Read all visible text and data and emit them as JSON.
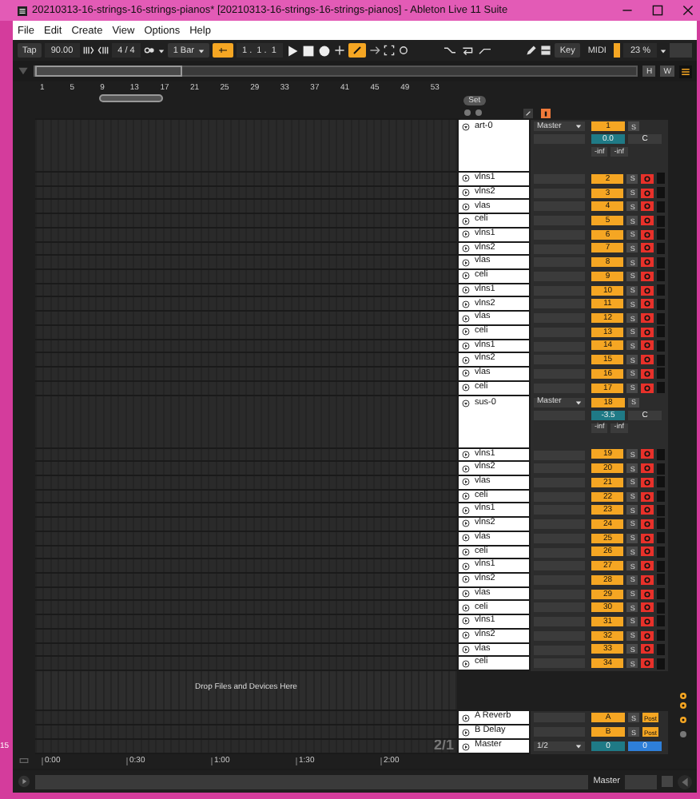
{
  "window": {
    "title": "20210313-16-strings-16-strings-pianos* [20210313-16-strings-16-strings-pianos] - Ableton Live 11 Suite"
  },
  "desktop_label": "15",
  "menu": [
    "File",
    "Edit",
    "Create",
    "View",
    "Options",
    "Help"
  ],
  "transport": {
    "tap": "Tap",
    "tempo": "90.00",
    "signature": "4 / 4",
    "quantization": "1 Bar",
    "position": "1 .  1 .  1",
    "follow_on": true,
    "automation_arm": true,
    "key": "Key",
    "midi": "MIDI",
    "cpu": "23 %"
  },
  "overview": {
    "buttons": [
      "H",
      "W"
    ]
  },
  "ruler": {
    "bars": [
      "1",
      "5",
      "9",
      "13",
      "17",
      "21",
      "25",
      "29",
      "33",
      "37",
      "41",
      "45",
      "49",
      "53"
    ]
  },
  "set_button": "Set",
  "groups": [
    {
      "name": "art-0",
      "output": "Master",
      "number": "1",
      "solo": "S",
      "volume": "0.0",
      "pan": "C",
      "peaks": [
        "-inf",
        "-inf"
      ],
      "tracks": [
        {
          "name": "vlns1",
          "number": "2",
          "solo": "S",
          "armed": true
        },
        {
          "name": "vlns2",
          "number": "3",
          "solo": "S",
          "armed": true
        },
        {
          "name": "vlas",
          "number": "4",
          "solo": "S",
          "armed": true
        },
        {
          "name": "celi",
          "number": "5",
          "solo": "S",
          "armed": true
        },
        {
          "name": "vlns1",
          "number": "6",
          "solo": "S",
          "armed": true
        },
        {
          "name": "vlns2",
          "number": "7",
          "solo": "S",
          "armed": true
        },
        {
          "name": "vlas",
          "number": "8",
          "solo": "S",
          "armed": true
        },
        {
          "name": "celi",
          "number": "9",
          "solo": "S",
          "armed": true
        },
        {
          "name": "vlns1",
          "number": "10",
          "solo": "S",
          "armed": true
        },
        {
          "name": "vlns2",
          "number": "11",
          "solo": "S",
          "armed": true
        },
        {
          "name": "vlas",
          "number": "12",
          "solo": "S",
          "armed": true
        },
        {
          "name": "celi",
          "number": "13",
          "solo": "S",
          "armed": true
        },
        {
          "name": "vlns1",
          "number": "14",
          "solo": "S",
          "armed": true
        },
        {
          "name": "vlns2",
          "number": "15",
          "solo": "S",
          "armed": true
        },
        {
          "name": "vlas",
          "number": "16",
          "solo": "S",
          "armed": true
        },
        {
          "name": "celi",
          "number": "17",
          "solo": "S",
          "armed": true
        }
      ]
    },
    {
      "name": "sus-0",
      "output": "Master",
      "number": "18",
      "solo": "S",
      "volume": "-3.5",
      "pan": "C",
      "peaks": [
        "-inf",
        "-inf"
      ],
      "tracks": [
        {
          "name": "vlns1",
          "number": "19",
          "solo": "S",
          "armed": true
        },
        {
          "name": "vlns2",
          "number": "20",
          "solo": "S",
          "armed": true
        },
        {
          "name": "vlas",
          "number": "21",
          "solo": "S",
          "armed": true
        },
        {
          "name": "celi",
          "number": "22",
          "solo": "S",
          "armed": true
        },
        {
          "name": "vlns1",
          "number": "23",
          "solo": "S",
          "armed": true
        },
        {
          "name": "vlns2",
          "number": "24",
          "solo": "S",
          "armed": true
        },
        {
          "name": "vlas",
          "number": "25",
          "solo": "S",
          "armed": true
        },
        {
          "name": "celi",
          "number": "26",
          "solo": "S",
          "armed": true
        },
        {
          "name": "vlns1",
          "number": "27",
          "solo": "S",
          "armed": true
        },
        {
          "name": "vlns2",
          "number": "28",
          "solo": "S",
          "armed": true
        },
        {
          "name": "vlas",
          "number": "29",
          "solo": "S",
          "armed": true
        },
        {
          "name": "celi",
          "number": "30",
          "solo": "S",
          "armed": true
        },
        {
          "name": "vlns1",
          "number": "31",
          "solo": "S",
          "armed": true
        },
        {
          "name": "vlns2",
          "number": "32",
          "solo": "S",
          "armed": true
        },
        {
          "name": "vlas",
          "number": "33",
          "solo": "S",
          "armed": true
        },
        {
          "name": "celi",
          "number": "34",
          "solo": "S",
          "armed": true
        }
      ]
    }
  ],
  "drop_hint": "Drop Files and Devices Here",
  "returns": [
    {
      "name": "A Reverb",
      "letter": "A",
      "solo": "S",
      "send_mode": "Post"
    },
    {
      "name": "B Delay",
      "letter": "B",
      "solo": "S",
      "send_mode": "Post"
    }
  ],
  "master": {
    "name": "Master",
    "output": "1/2",
    "volume": "0",
    "pan": "0"
  },
  "zoom_ratio": "2/1",
  "time_ruler": [
    "0:00",
    "0:30",
    "1:00",
    "1:30",
    "2:00"
  ],
  "status": {
    "label": "Master"
  }
}
